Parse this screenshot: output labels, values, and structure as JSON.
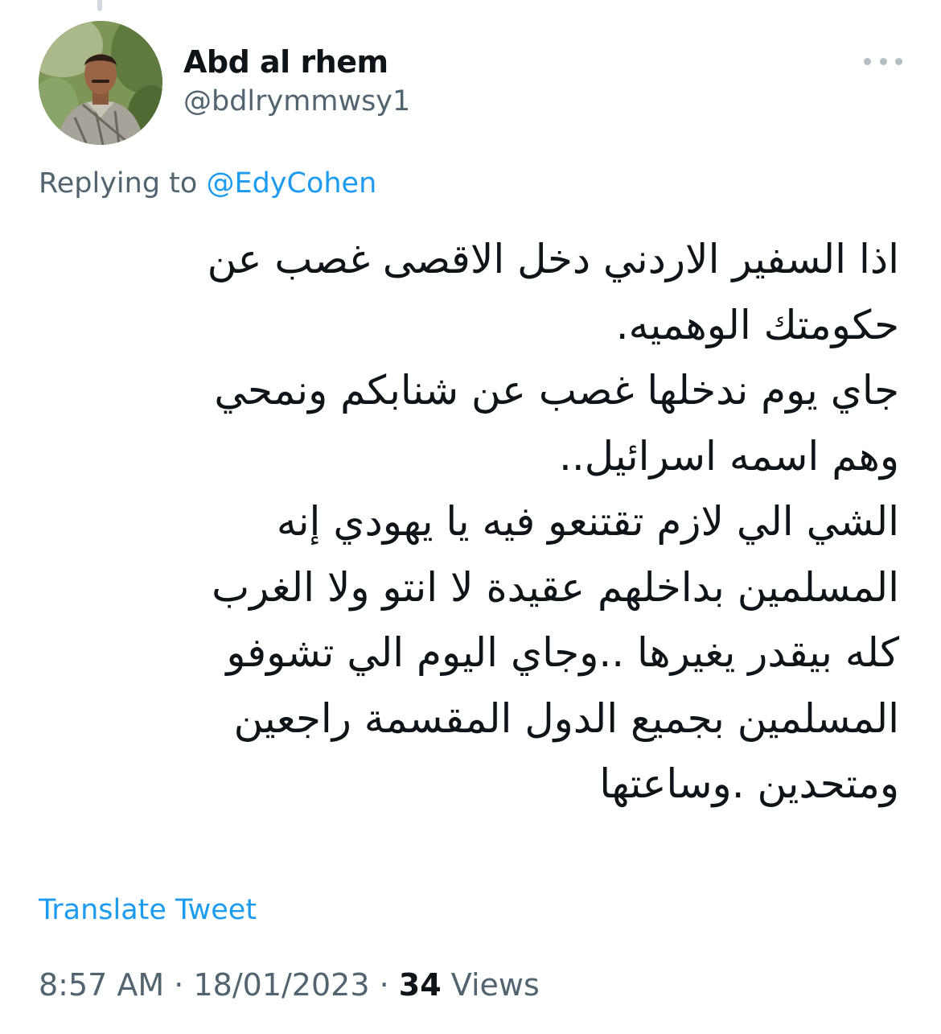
{
  "tweet": {
    "author": {
      "display_name": "Abd al rhem",
      "handle": "@bdlrymmwsy1"
    },
    "more_icon": "more-horizontal-icon",
    "reply_context": {
      "prefix": "Replying to",
      "mention": "@EdyCohen"
    },
    "text_lines": [
      "اذا السفير الاردني دخل الاقصى غصب عن",
      "حكومتك الوهميه.",
      "جاي يوم ندخلها غصب عن شنابكم ونمحي",
      "وهم اسمه اسرائيل..",
      "الشي الي لازم تقتنعو فيه يا يهودي إنه",
      "المسلمين بداخلهم عقيدة لا انتو ولا الغرب",
      "كله بيقدر يغيرها ..وجاي اليوم الي تشوفو",
      "المسلمين بجميع الدول المقسمة راجعين",
      "ومتحدين .وساعتها"
    ],
    "translate_label": "Translate Tweet",
    "time": "8:57 AM",
    "date": "18/01/2023",
    "separator": "·",
    "views_count": "34",
    "views_label": "Views"
  },
  "colors": {
    "text_primary": "#0f1419",
    "text_secondary": "#536471",
    "link": "#1d9bf0"
  }
}
